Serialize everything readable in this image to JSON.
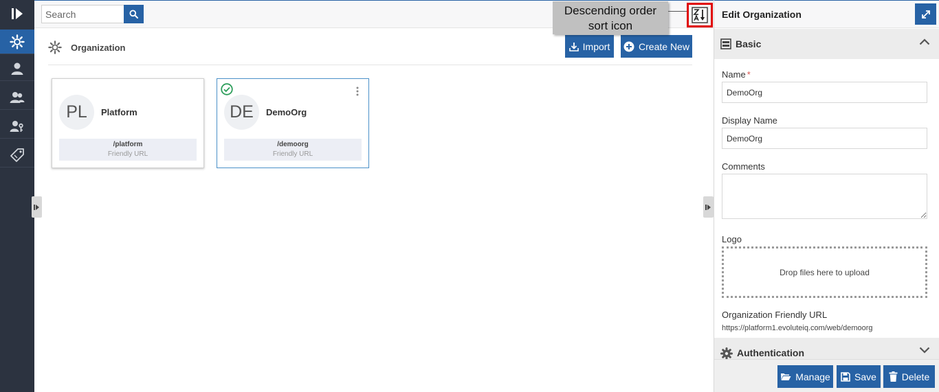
{
  "search": {
    "placeholder": "Search"
  },
  "callout": {
    "line1": "Descending order",
    "line2": "sort icon"
  },
  "section": {
    "title": "Organization"
  },
  "toolbar": {
    "import_label": "Import",
    "create_label": "Create New"
  },
  "cards": [
    {
      "initials": "PL",
      "name": "Platform",
      "url": "/platform",
      "url_label": "Friendly URL",
      "selected": false
    },
    {
      "initials": "DE",
      "name": "DemoOrg",
      "url": "/demoorg",
      "url_label": "Friendly URL",
      "selected": true
    }
  ],
  "rail": {
    "icons": [
      "logo-icon",
      "organization-gear-icon",
      "user-icon",
      "users-group-icon",
      "user-key-icon",
      "tag-icon"
    ]
  },
  "panel": {
    "title": "Edit Organization",
    "basic_label": "Basic",
    "name_label": "Name",
    "name_required": "*",
    "name_value": "DemoOrg",
    "display_name_label": "Display Name",
    "display_name_value": "DemoOrg",
    "comments_label": "Comments",
    "comments_value": "",
    "logo_label": "Logo",
    "drop_text": "Drop files here to upload",
    "friendly_url_label": "Organization Friendly URL",
    "friendly_url_value": "https://platform1.evoluteiq.com/web/demoorg",
    "auth_label": "Authentication"
  },
  "footer": {
    "manage_label": "Manage",
    "save_label": "Save",
    "delete_label": "Delete"
  },
  "colors": {
    "primary": "#2762a5",
    "rail": "#2c3340",
    "highlight": "#e00000",
    "success": "#2e9e5b"
  }
}
